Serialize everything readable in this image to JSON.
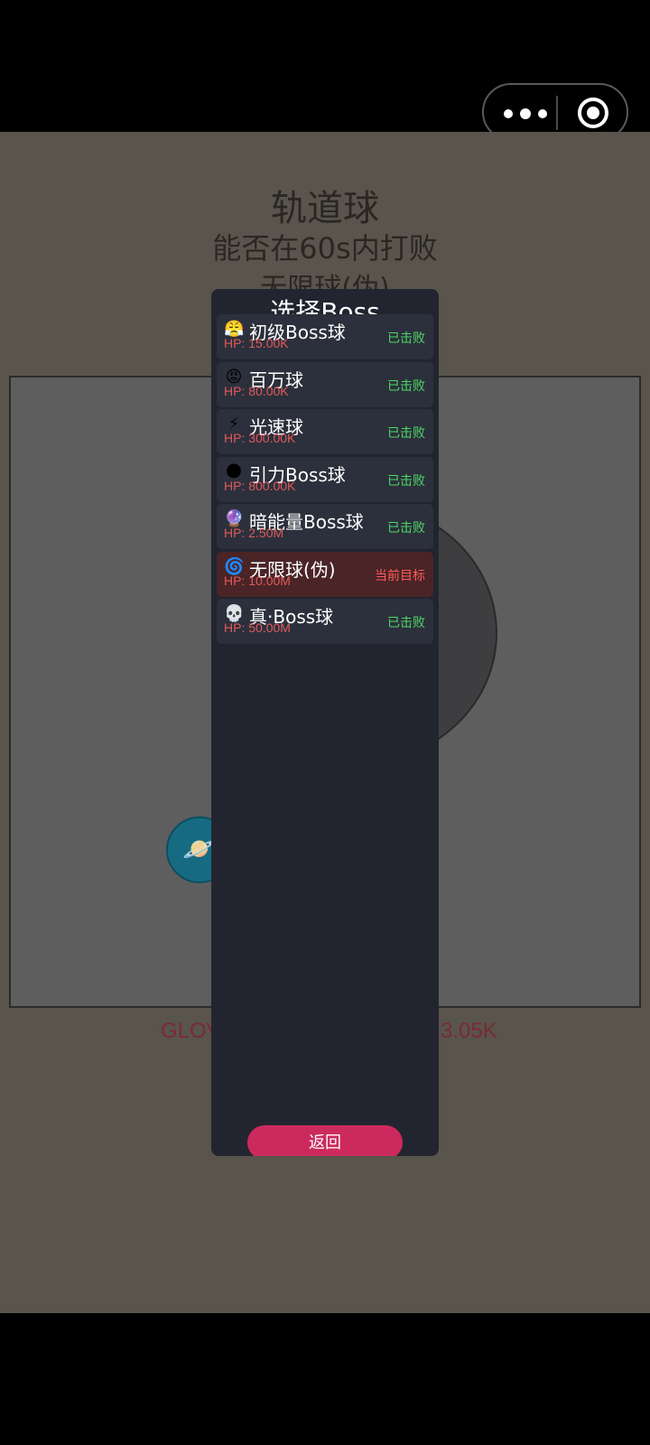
{
  "header": {
    "menu_icon": "more-dots-icon",
    "close_icon": "target-circle-icon"
  },
  "game": {
    "title": "轨道球",
    "subtitle": "能否在60s内打败",
    "target_line": "无限球(伪)",
    "footer_left": "GLOV",
    "footer_right": "3.05K",
    "player_icon": "🪐"
  },
  "modal": {
    "title": "选择Boss",
    "bosses": [
      {
        "icon": "😤",
        "name": "初级Boss球",
        "hp": "HP: 15.00K",
        "status": "已击败"
      },
      {
        "icon": "😡",
        "name": "百万球",
        "hp": "HP: 80.00K",
        "status": "已击败"
      },
      {
        "icon": "⚡",
        "name": "光速球",
        "hp": "HP: 300.00K",
        "status": "已击败"
      },
      {
        "icon": "🌑",
        "name": "引力Boss球",
        "hp": "HP: 800.00K",
        "status": "已击败"
      },
      {
        "icon": "🔮",
        "name": "暗能量Boss球",
        "hp": "HP: 2.50M",
        "status": "已击败"
      },
      {
        "icon": "🌀",
        "name": "无限球(伪)",
        "hp": "HP: 10.00M",
        "status": "当前目标"
      },
      {
        "icon": "💀",
        "name": "真·Boss球",
        "hp": "HP: 50.00M",
        "status": "已击败"
      }
    ],
    "back_label": "返回"
  },
  "colors": {
    "defeated": "#4cd964",
    "current": "#ff5a5a",
    "back_button": "#cc2a5e"
  }
}
